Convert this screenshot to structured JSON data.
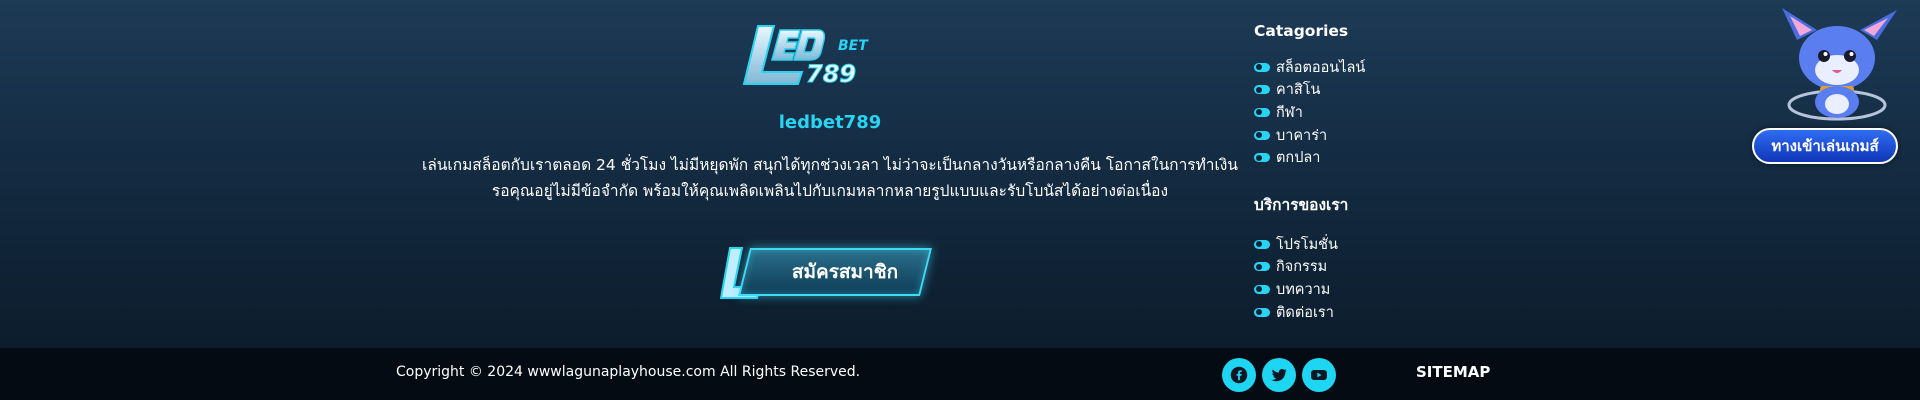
{
  "brand": {
    "logo_text_top": "LED",
    "logo_text_bet": "BET",
    "logo_text_num": "789",
    "name": "ledbet789",
    "description_line1": "เล่นเกมสล็อตกับเราตลอด 24 ชั่วโมง ไม่มีหยุดพัก สนุกได้ทุกช่วงเวลา ไม่ว่าจะเป็นกลางวันหรือกลางคืน โอกาสในการทำเงิน",
    "description_line2": "รอคุณอยู่ไม่มีข้อจำกัด พร้อมให้คุณเพลิดเพลินไปกับเกมหลากหลายรูปแบบและรับโบนัสได้อย่างต่อเนื่อง"
  },
  "register_button": {
    "label": "สมัครสมาชิก"
  },
  "categories": {
    "title": "Catagories",
    "items": [
      "สล็อตออนไลน์",
      "คาสิโน",
      "กีฬา",
      "บาคาร่า",
      "ตกปลา"
    ]
  },
  "services": {
    "title": "บริการของเรา",
    "items": [
      "โปรโมชั่น",
      "กิจกรรม",
      "บทความ",
      "ติดต่อเรา"
    ]
  },
  "mascot": {
    "button_label": "ทางเข้าเล่นเกมส์"
  },
  "footer": {
    "copyright": "Copyright © 2024 wwwlagunaplayhouse.com All Rights Reserved.",
    "sitemap": "SITEMAP",
    "social_icons": [
      "facebook-icon",
      "twitter-icon",
      "youtube-icon"
    ]
  },
  "colors": {
    "accent": "#29d3f2",
    "background_top": "#1d3a56",
    "footer_bg": "#050b12",
    "mascot_button": "#1f4fd8"
  }
}
